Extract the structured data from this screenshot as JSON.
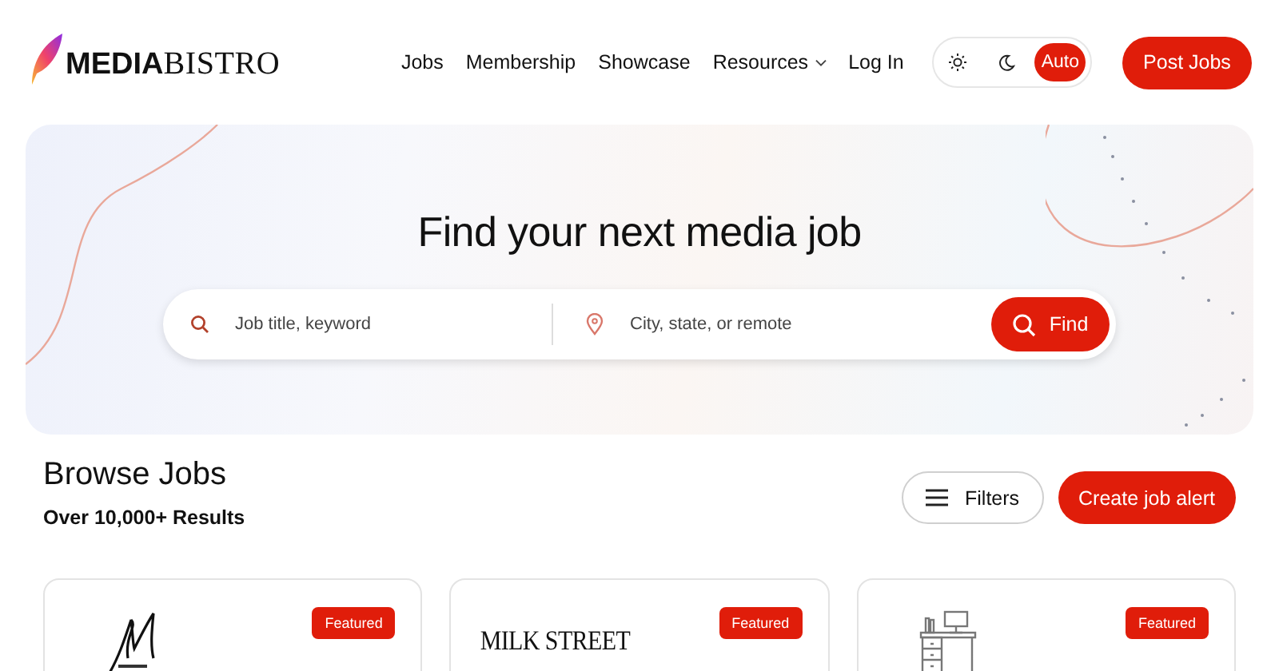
{
  "header": {
    "logo": "**MEDIA**BISTRO",
    "nav": [
      {
        "label": "Jobs",
        "has_menu": false
      },
      {
        "label": "Membership",
        "has_menu": false
      },
      {
        "label": "Showcase",
        "has_menu": false
      },
      {
        "label": "Resources",
        "has_menu": true
      },
      {
        "label": "Log In",
        "has_menu": false
      }
    ],
    "theme_modes": [
      {
        "kind": "sun",
        "selected": false
      },
      {
        "kind": "moon",
        "selected": false
      },
      {
        "kind": "text",
        "label": "Auto",
        "selected": true
      }
    ],
    "post_button": "Post Jobs"
  },
  "hero": {
    "title": "Find your next media job",
    "search": {
      "keyword_placeholder": "Job title, keyword",
      "location_placeholder": "City, state, or remote",
      "button": "Find"
    }
  },
  "browse": {
    "title": "Browse Jobs",
    "count": "Over 10,000+ Results",
    "filters_button": "Filters",
    "alert_button": "Create job alert"
  },
  "cards": [
    {
      "kind": "monogram",
      "badge": "Featured"
    },
    {
      "kind": "wordmark",
      "logo_text": "MILK STREET",
      "badge": "Featured"
    },
    {
      "kind": "desk",
      "badge": "Featured"
    }
  ]
}
